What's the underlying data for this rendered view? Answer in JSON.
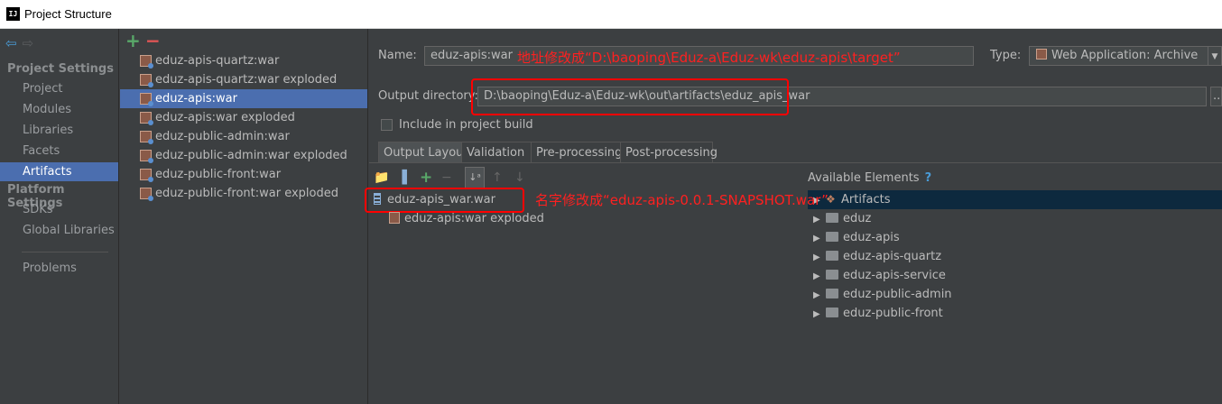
{
  "window": {
    "title": "Project Structure",
    "icon_text": "IJ"
  },
  "left_nav": {
    "project_settings_header": "Project Settings",
    "project_items": [
      "Project",
      "Modules",
      "Libraries",
      "Facets",
      "Artifacts"
    ],
    "platform_settings_header": "Platform Settings",
    "platform_items": [
      "SDKs",
      "Global Libraries"
    ],
    "problems": "Problems",
    "selected": "Artifacts"
  },
  "artifact_list": {
    "items": [
      "eduz-apis-quartz:war",
      "eduz-apis-quartz:war exploded",
      "eduz-apis:war",
      "eduz-apis:war exploded",
      "eduz-public-admin:war",
      "eduz-public-admin:war exploded",
      "eduz-public-front:war",
      "eduz-public-front:war exploded"
    ],
    "selected_index": 2
  },
  "details": {
    "name_label": "Name:",
    "name_value": "eduz-apis:war",
    "type_label": "Type:",
    "type_value": "Web Application: Archive",
    "output_dir_label": "Output directory:",
    "output_dir_value": "D:\\baoping\\Eduz-a\\Eduz-wk\\out\\artifacts\\eduz_apis_war",
    "include_label": "Include in project build",
    "tabs": [
      "Output Layout",
      "Validation",
      "Pre-processing",
      "Post-processing"
    ],
    "active_tab": "Output Layout"
  },
  "output_layout": {
    "root": "eduz-apis_war.war",
    "child": "eduz-apis:war exploded"
  },
  "available_elements": {
    "header": "Available Elements",
    "help": "?",
    "items": [
      "Artifacts",
      "eduz",
      "eduz-apis",
      "eduz-apis-quartz",
      "eduz-apis-service",
      "eduz-public-admin",
      "eduz-public-front"
    ]
  },
  "annotations": {
    "path_note": "地址修改成“D:\\baoping\\Eduz-a\\Eduz-wk\\eduz-apis\\target”",
    "name_note": "名字修改成“eduz-apis-0.0.1-SNAPSHOT.war”"
  },
  "colors": {
    "selection": "#4b6eaf",
    "background": "#3c3f41",
    "annotation": "#ff0000"
  }
}
